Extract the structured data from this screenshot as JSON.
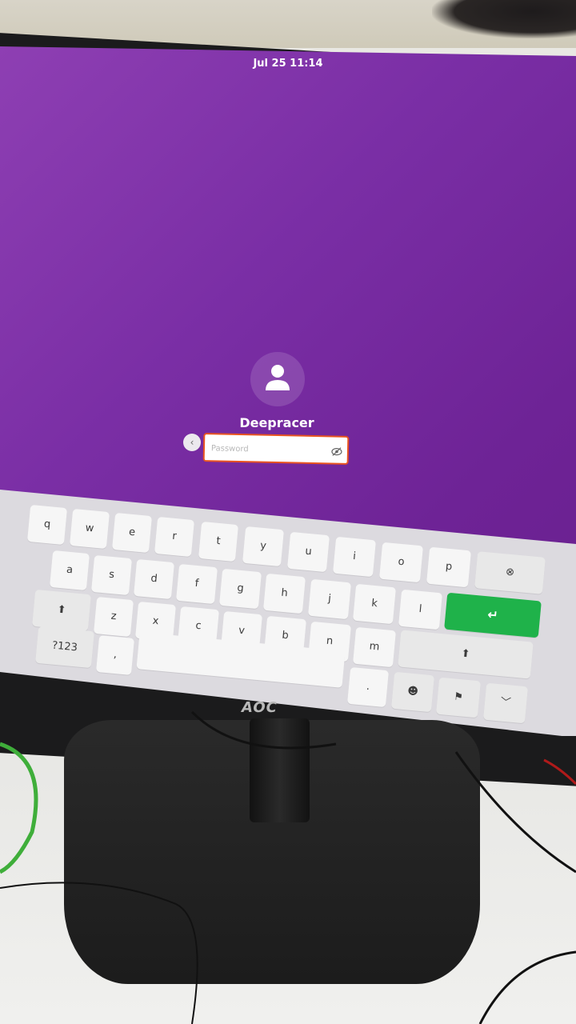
{
  "topbar": {
    "datetime": "Jul 25  11:14"
  },
  "login": {
    "username": "Deepracer",
    "password_placeholder": "Password",
    "back_label": "‹"
  },
  "keyboard": {
    "row1": [
      "q",
      "w",
      "e",
      "r",
      "t",
      "y",
      "u",
      "i",
      "o",
      "p"
    ],
    "row2": [
      "a",
      "s",
      "d",
      "f",
      "g",
      "h",
      "j",
      "k",
      "l"
    ],
    "row3": [
      "z",
      "x",
      "c",
      "v",
      "b",
      "n",
      "m"
    ],
    "numbers_label": "?123",
    "comma_label": ",",
    "period_label": ".",
    "shift_label": "⬆",
    "backspace_label": "⊗",
    "enter_label": "↵",
    "emoji_label": "☻",
    "language_label": "⚑",
    "hide_label": "﹀"
  },
  "monitor": {
    "brand": "AOC"
  },
  "colors": {
    "wallpaper": "#7a2ea5",
    "accent": "#e95420",
    "enter_key": "#1fb24a"
  }
}
